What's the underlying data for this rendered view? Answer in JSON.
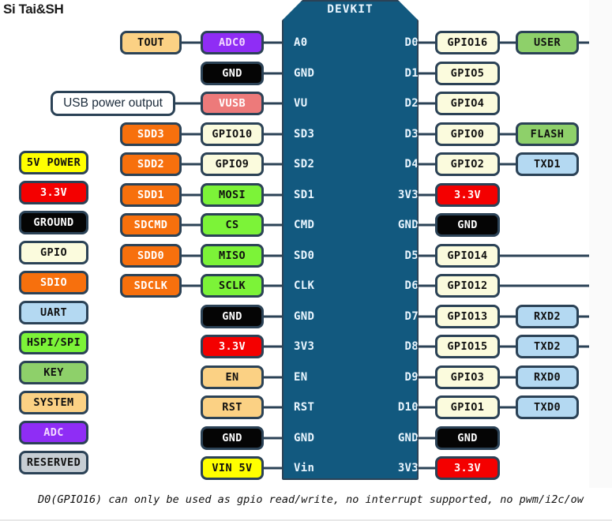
{
  "watermark": "Si Tai&SH",
  "board": {
    "title": "DEVKIT",
    "left_pins": [
      "A0",
      "GND",
      "VU",
      "SD3",
      "SD2",
      "SD1",
      "CMD",
      "SD0",
      "CLK",
      "GND",
      "3V3",
      "EN",
      "RST",
      "GND",
      "Vin"
    ],
    "right_pins": [
      "D0",
      "D1",
      "D2",
      "D3",
      "D4",
      "3V3",
      "GND",
      "D5",
      "D6",
      "D7",
      "D8",
      "D9",
      "D10",
      "GND",
      "3V3"
    ]
  },
  "legend": [
    {
      "label": "5V POWER",
      "color_class": "c-power5v",
      "hex": "#ffff00"
    },
    {
      "label": "3.3V",
      "color_class": "c-v33",
      "hex": "#f40000"
    },
    {
      "label": "GROUND",
      "color_class": "c-ground",
      "hex": "#050505"
    },
    {
      "label": "GPIO",
      "color_class": "c-gpio",
      "hex": "#fbfbdd"
    },
    {
      "label": "SDIO",
      "color_class": "c-sdio",
      "hex": "#f7700d"
    },
    {
      "label": "UART",
      "color_class": "c-uart",
      "hex": "#b4d9f2"
    },
    {
      "label": "HSPI/SPI",
      "color_class": "c-hspi",
      "hex": "#7cf338"
    },
    {
      "label": "KEY",
      "color_class": "c-key",
      "hex": "#8ed06a"
    },
    {
      "label": "SYSTEM",
      "color_class": "c-system",
      "hex": "#fbd184"
    },
    {
      "label": "ADC",
      "color_class": "c-adc",
      "hex": "#8f2df5"
    },
    {
      "label": "RESERVED",
      "color_class": "c-reserved",
      "hex": "#c6cdd3"
    }
  ],
  "left_outer": [
    {
      "label": "TOUT",
      "color_class": "c-system"
    },
    {
      "label": "SDD3",
      "color_class": "c-sdio"
    },
    {
      "label": "SDD2",
      "color_class": "c-sdio"
    },
    {
      "label": "SDD1",
      "color_class": "c-sdio"
    },
    {
      "label": "SDCMD",
      "color_class": "c-sdio"
    },
    {
      "label": "SDD0",
      "color_class": "c-sdio"
    },
    {
      "label": "SDCLK",
      "color_class": "c-sdio"
    }
  ],
  "usb_power_output": "USB power output",
  "left_inner": [
    {
      "label": "ADC0",
      "color_class": "c-adc"
    },
    {
      "label": "GND",
      "color_class": "c-ground"
    },
    {
      "label": "VUSB",
      "color_class": "c-vusb"
    },
    {
      "label": "GPIO10",
      "color_class": "c-gpio"
    },
    {
      "label": "GPIO9",
      "color_class": "c-gpio"
    },
    {
      "label": "MOSI",
      "color_class": "c-hspi"
    },
    {
      "label": "CS",
      "color_class": "c-hspi"
    },
    {
      "label": "MISO",
      "color_class": "c-hspi"
    },
    {
      "label": "SCLK",
      "color_class": "c-hspi"
    },
    {
      "label": "GND",
      "color_class": "c-ground"
    },
    {
      "label": "3.3V",
      "color_class": "c-v33"
    },
    {
      "label": "EN",
      "color_class": "c-system"
    },
    {
      "label": "RST",
      "color_class": "c-system"
    },
    {
      "label": "GND",
      "color_class": "c-ground"
    },
    {
      "label": "VIN 5V",
      "color_class": "c-power5v"
    }
  ],
  "right_inner": [
    {
      "label": "GPIO16",
      "color_class": "c-gpio"
    },
    {
      "label": "GPIO5",
      "color_class": "c-gpio"
    },
    {
      "label": "GPIO4",
      "color_class": "c-gpio"
    },
    {
      "label": "GPIO0",
      "color_class": "c-gpio"
    },
    {
      "label": "GPIO2",
      "color_class": "c-gpio"
    },
    {
      "label": "3.3V",
      "color_class": "c-v33"
    },
    {
      "label": "GND",
      "color_class": "c-ground"
    },
    {
      "label": "GPIO14",
      "color_class": "c-gpio"
    },
    {
      "label": "GPIO12",
      "color_class": "c-gpio"
    },
    {
      "label": "GPIO13",
      "color_class": "c-gpio"
    },
    {
      "label": "GPIO15",
      "color_class": "c-gpio"
    },
    {
      "label": "GPIO3",
      "color_class": "c-gpio"
    },
    {
      "label": "GPIO1",
      "color_class": "c-gpio"
    },
    {
      "label": "GND",
      "color_class": "c-ground"
    },
    {
      "label": "3.3V",
      "color_class": "c-v33"
    }
  ],
  "right_outer": [
    {
      "label": "USER",
      "color_class": "c-key",
      "row": 0
    },
    {
      "label": "FLASH",
      "color_class": "c-key",
      "row": 3
    },
    {
      "label": "TXD1",
      "color_class": "c-uart",
      "row": 4
    },
    {
      "label": "RXD2",
      "color_class": "c-uart",
      "row": 9
    },
    {
      "label": "TXD2",
      "color_class": "c-uart",
      "row": 10
    },
    {
      "label": "RXD0",
      "color_class": "c-uart",
      "row": 11
    },
    {
      "label": "TXD0",
      "color_class": "c-uart",
      "row": 12
    }
  ],
  "footnote": "D0(GPIO16) can only be used as gpio read/write, no interrupt supported, no pwm/i2c/ow",
  "colors": {
    "board": "#12597f",
    "outline": "#2b4256",
    "board_text": "#eaf6ff"
  }
}
